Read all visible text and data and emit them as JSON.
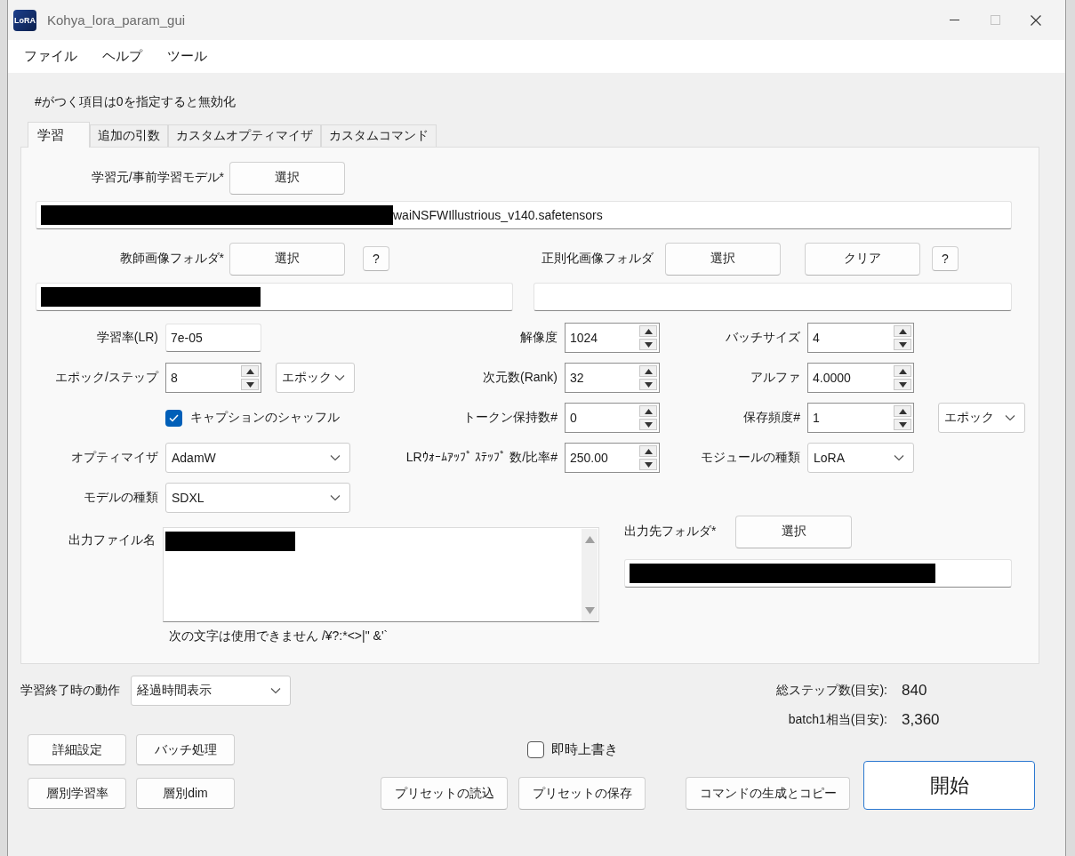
{
  "window": {
    "title": "Kohya_lora_param_gui",
    "icon_text": "LoRA",
    "maximize_disabled": true
  },
  "menu": [
    "ファイル",
    "ヘルプ",
    "ツール"
  ],
  "notice": "#がつく項目は0を指定すると無効化",
  "tabs": [
    {
      "label": "学習",
      "selected": true
    },
    {
      "label": "追加の引数",
      "selected": false
    },
    {
      "label": "カスタムオプティマイザ",
      "selected": false
    },
    {
      "label": "カスタムコマンド",
      "selected": false
    }
  ],
  "model": {
    "label": "学習元/事前学習モデル*",
    "button": "選択",
    "value": "waiNSFWIllustrious_v140.safetensors",
    "redacted": true
  },
  "train_folder": {
    "label": "教師画像フォルダ*",
    "button": "選択",
    "help": "?",
    "redacted": true
  },
  "reg_folder": {
    "label": "正則化画像フォルダ",
    "button": "選択",
    "clear": "クリア",
    "help": "?",
    "redacted": false
  },
  "rows": [
    [
      {
        "kind": "text",
        "label": "学習率(LR)",
        "value": "7e-05"
      },
      {
        "kind": "spin",
        "label": "解像度",
        "value": "1024"
      },
      {
        "kind": "spin",
        "label": "バッチサイズ",
        "value": "4"
      }
    ],
    [
      {
        "kind": "spin",
        "label": "エポック/ステップ",
        "value": "8",
        "unit": "エポック"
      },
      {
        "kind": "spin",
        "label": "次元数(Rank)",
        "value": "32"
      },
      {
        "kind": "spin",
        "label": "アルファ",
        "value": "4.0000"
      }
    ],
    [
      {
        "kind": "checkbox",
        "label": "キャプションのシャッフル",
        "checked": true
      },
      {
        "kind": "spin",
        "label": "トークン保持数#",
        "value": "0"
      },
      {
        "kind": "spin",
        "label": "保存頻度#",
        "value": "1",
        "unit": "エポック"
      }
    ],
    [
      {
        "kind": "dropdown",
        "label": "オプティマイザ",
        "value": "AdamW"
      },
      {
        "kind": "spin",
        "label": "LRｳｫｰﾑｱｯﾌﾟ ｽﾃｯﾌﾟ 数/比率#",
        "value": "250.00"
      },
      {
        "kind": "dropdown",
        "label": "モジュールの種類",
        "value": "LoRA"
      }
    ],
    [
      {
        "kind": "dropdown",
        "label": "モデルの種類",
        "value": "SDXL"
      }
    ]
  ],
  "output_name": {
    "label": "出力ファイル名",
    "redacted": true,
    "hint": "次の文字は使用できません /¥?:*<>|\" &'`"
  },
  "output_folder": {
    "label": "出力先フォルダ*",
    "button": "選択",
    "redacted": true
  },
  "end_action": {
    "label": "学習終了時の動作",
    "value": "経過時間表示"
  },
  "estimates": [
    {
      "label": "総ステップ数(目安):",
      "value": "840"
    },
    {
      "label": "batch1相当(目安):",
      "value": "3,360"
    }
  ],
  "left_buttons": [
    "詳細設定",
    "バッチ処理",
    "層別学習率",
    "層別dim"
  ],
  "overwrite": {
    "label": "即時上書き",
    "checked": false
  },
  "preset_buttons": [
    "プリセットの読込",
    "プリセットの保存"
  ],
  "command_button": "コマンドの生成とコピー",
  "start_button": "開始"
}
